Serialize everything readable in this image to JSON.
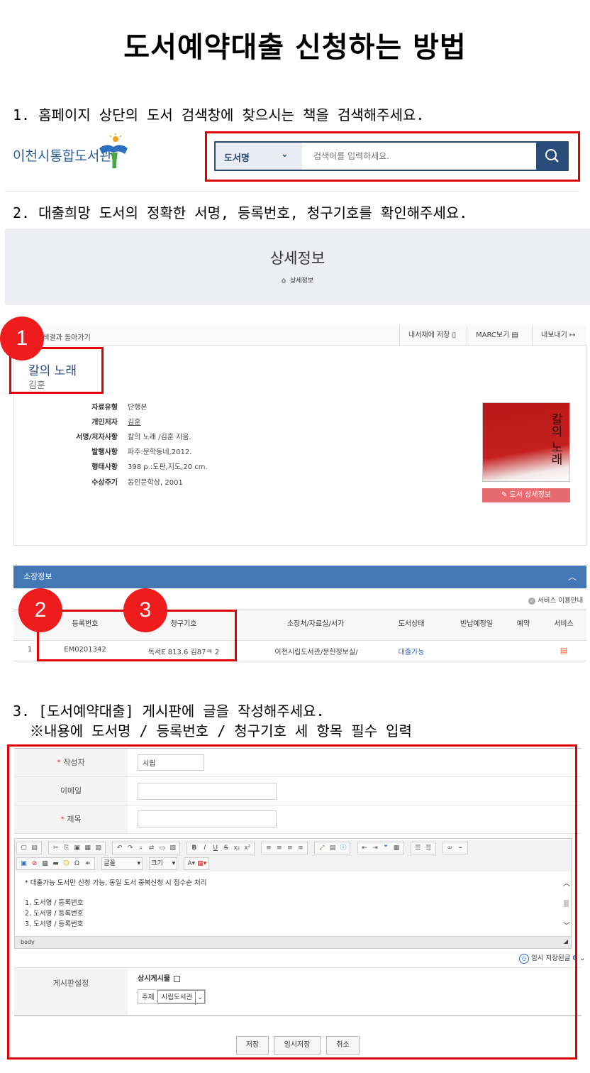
{
  "title": "도서예약대출 신청하는 방법",
  "step1": {
    "text": "1. 홈페이지 상단의 도서 검색창에 찾으시는 책을 검색해주세요.",
    "logo_text": "이천시통합도서관",
    "search_select": "도서명",
    "search_placeholder": "검색어를 입력하세요."
  },
  "step2": {
    "text": "2. 대출희망 도서의 정확한 서명, 등록번호, 청구기호를 확인해주세요.",
    "detail_title": "상세정보",
    "breadcrumb": "상세정보",
    "back_label": "검색결과 돌아가기",
    "actions": [
      "내서재에 저장",
      "MARC보기",
      "내보내기"
    ],
    "book_title": "칼의 노래",
    "book_author": "김훈",
    "meta": [
      {
        "label": "자료유형",
        "value": "단행본"
      },
      {
        "label": "개인저자",
        "value": "김훈"
      },
      {
        "label": "서명/저자사항",
        "value": "칼의 노래 /김훈 지음."
      },
      {
        "label": "발행사항",
        "value": "파주:문학동네,2012."
      },
      {
        "label": "형태사항",
        "value": "398 p.:도판,지도,20 cm."
      },
      {
        "label": "수상주기",
        "value": "동인문학상, 2001"
      }
    ],
    "cover_title": "칼의 노래",
    "cover_button": "도서 상세정보",
    "holdings_title": "소장정보",
    "service_guide": "서비스 이용안내",
    "columns": [
      "등록번호",
      "청구기호",
      "소장처/자료실/서가",
      "도서상태",
      "반납예정일",
      "예약",
      "서비스"
    ],
    "row": {
      "no": "1",
      "reg_no": "EM0201342",
      "call_no": "독서E 813.6 김87ㅋ 2",
      "location": "이천시립도서관/문헌정보실/",
      "status": "대출가능"
    },
    "markers": [
      "1",
      "2",
      "3"
    ]
  },
  "step3": {
    "text_line1": "3. [도서예약대출] 게시판에 글을 작성해주세요.",
    "text_line2": "※내용에 도서명 / 등록번호 / 청구기호 세 항목 필수 입력",
    "required_mark": "*",
    "author_label": "작성자",
    "author_value": "시립",
    "email_label": "이메일",
    "subject_label": "제목",
    "font_select": "글꼴",
    "size_select": "크기",
    "editor_lines": [
      "* 대출가능 도서만 신청 가능, 동일 도서 중복신청 시 접수순 처리",
      "1. 도서명 / 등록번호",
      "2. 도서명 / 등록번호",
      "3. 도서명 / 등록번호"
    ],
    "editor_status": "body",
    "autosave_label": "임시 저장된글",
    "autosave_count": "0",
    "board_settings_label": "게시판설정",
    "notice_label": "상시게시물",
    "topic_label": "주제",
    "topic_value": "시립도서관",
    "buttons": {
      "save": "저장",
      "temp_save": "임시저장",
      "cancel": "취소"
    }
  }
}
